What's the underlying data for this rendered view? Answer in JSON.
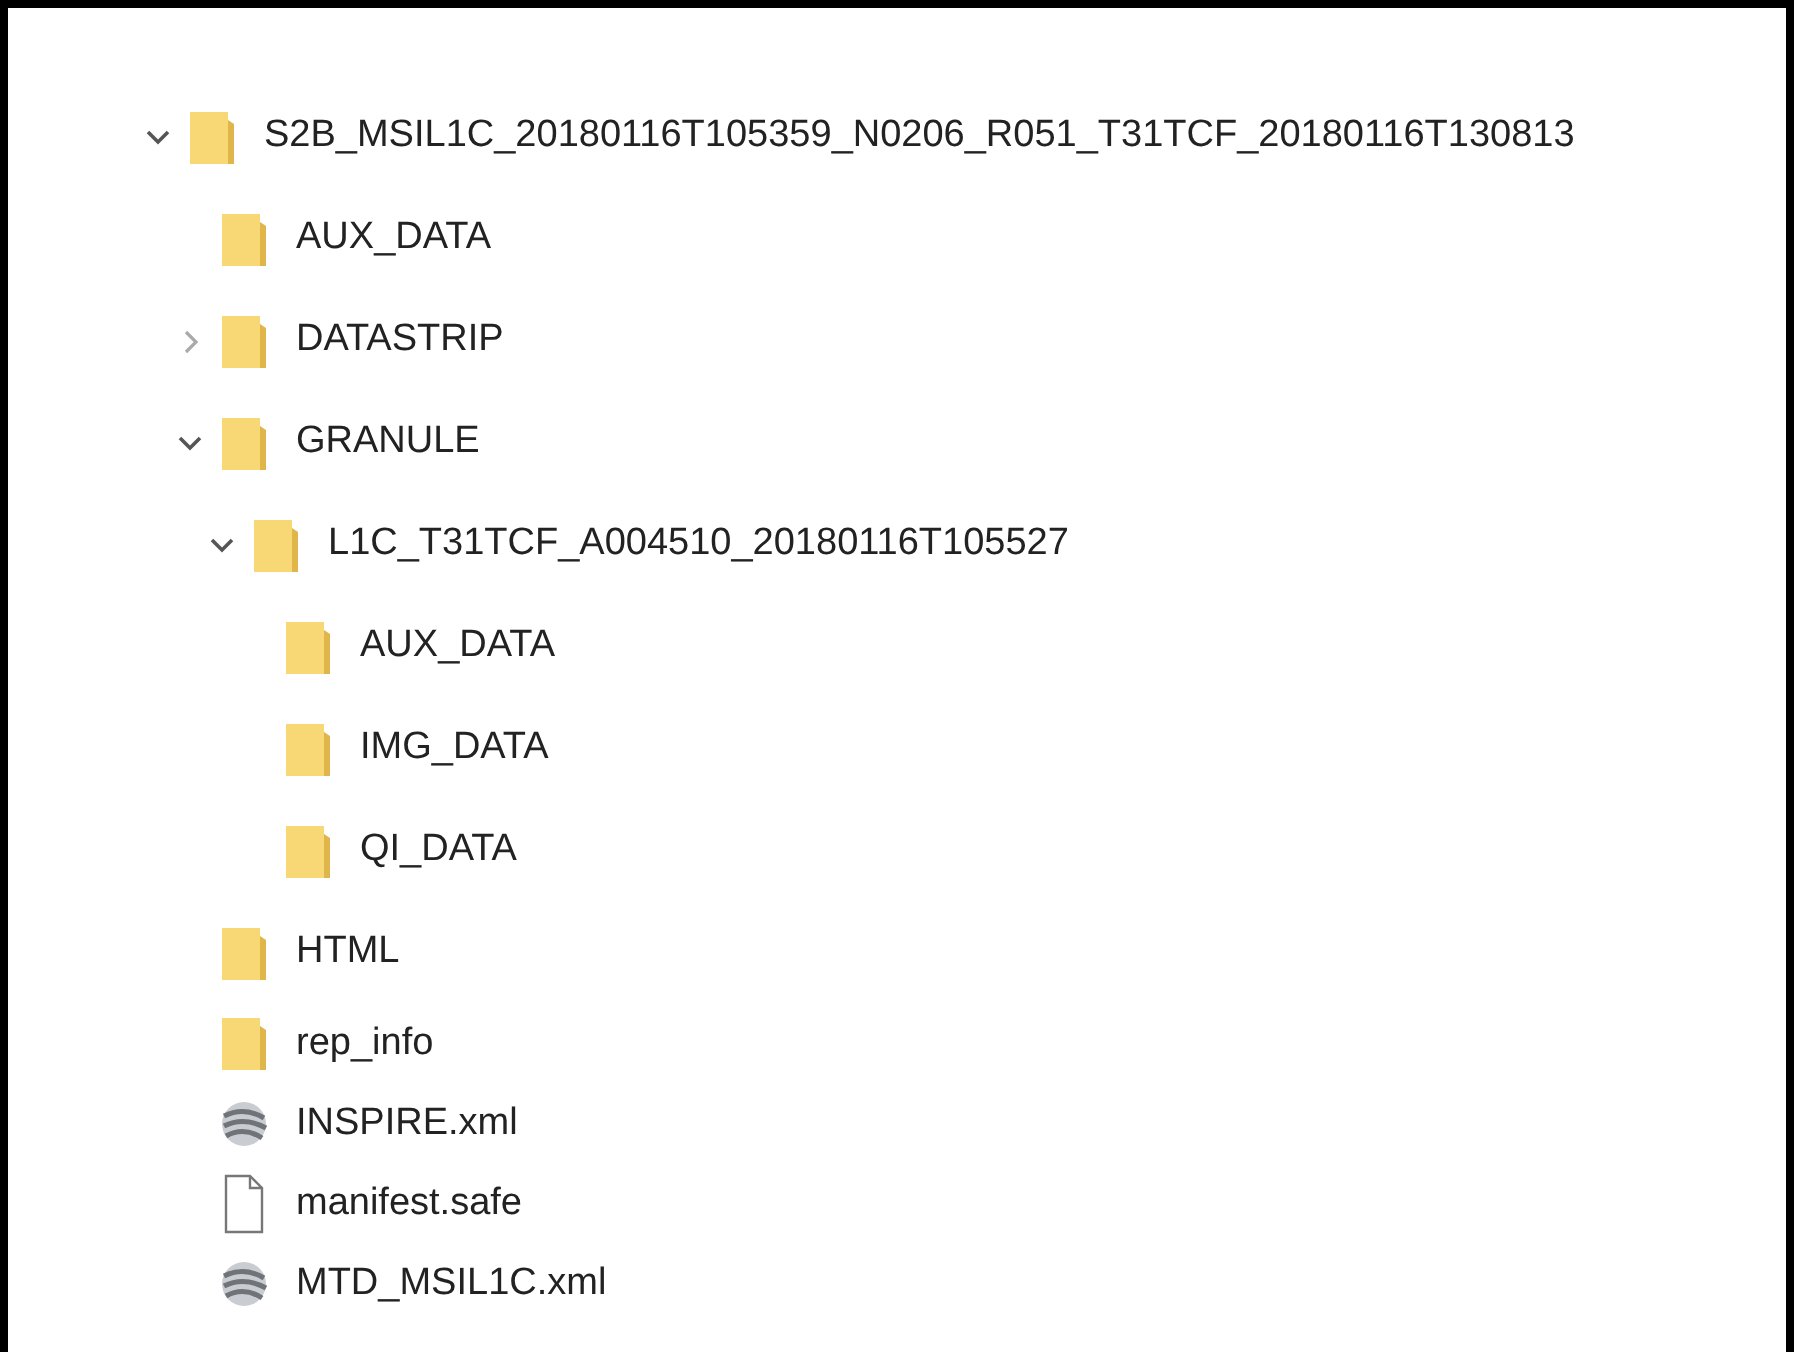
{
  "tree": [
    {
      "kind": "folder",
      "label": "S2B_MSIL1C_20180116T105359_N0206_R051_T31TCF_20180116T130813",
      "expanded": true,
      "children": [
        {
          "kind": "folder",
          "label": "AUX_DATA"
        },
        {
          "kind": "folder",
          "label": "DATASTRIP",
          "expanded": false
        },
        {
          "kind": "folder",
          "label": "GRANULE",
          "expanded": true,
          "children": [
            {
              "kind": "folder",
              "label": "L1C_T31TCF_A004510_20180116T105527",
              "expanded": true,
              "children": [
                {
                  "kind": "folder",
                  "label": "AUX_DATA"
                },
                {
                  "kind": "folder",
                  "label": "IMG_DATA"
                },
                {
                  "kind": "folder",
                  "label": "QI_DATA"
                }
              ]
            }
          ]
        },
        {
          "kind": "folder",
          "label": "HTML"
        },
        {
          "kind": "folder",
          "label": "rep_info"
        },
        {
          "kind": "xml",
          "label": "INSPIRE.xml"
        },
        {
          "kind": "file",
          "label": "manifest.safe"
        },
        {
          "kind": "xml",
          "label": "MTD_MSIL1C.xml"
        }
      ]
    }
  ]
}
